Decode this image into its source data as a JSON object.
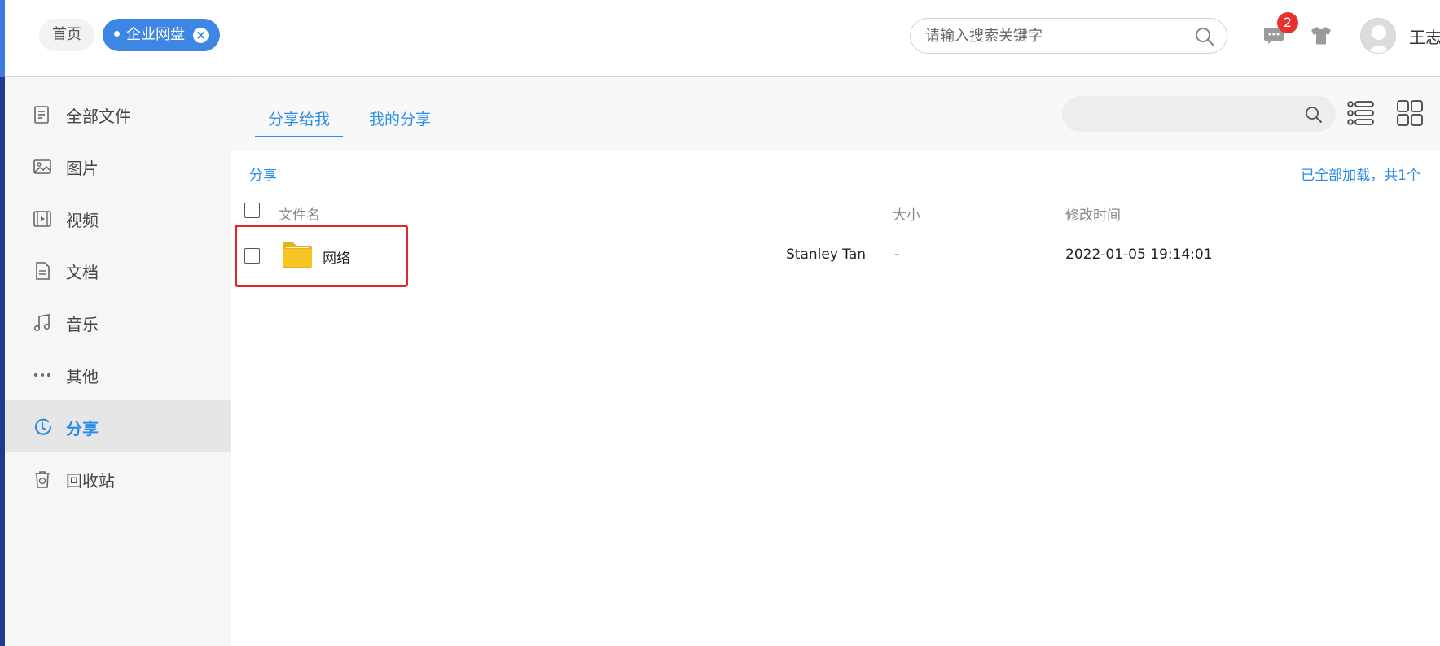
{
  "header": {
    "tabs": [
      {
        "label": "首页"
      },
      {
        "label": "企业网盘"
      }
    ],
    "search": {
      "placeholder": "请输入搜索关键字"
    },
    "message_count": "2",
    "username": "王志强"
  },
  "sidebar": {
    "items": [
      {
        "label": "全部文件",
        "icon": "file-list-icon"
      },
      {
        "label": "图片",
        "icon": "image-icon"
      },
      {
        "label": "视频",
        "icon": "video-icon"
      },
      {
        "label": "文档",
        "icon": "document-icon"
      },
      {
        "label": "音乐",
        "icon": "music-icon"
      },
      {
        "label": "其他",
        "icon": "more-icon"
      },
      {
        "label": "分享",
        "icon": "share-icon",
        "active": true
      },
      {
        "label": "回收站",
        "icon": "recycle-bin-icon"
      }
    ]
  },
  "main": {
    "tabs": [
      {
        "label": "分享给我",
        "active": true
      },
      {
        "label": "我的分享"
      }
    ],
    "breadcrumb": "分享",
    "load_status": "已全部加载，共1个",
    "columns": {
      "name": "文件名",
      "size": "大小",
      "modified": "修改时间"
    },
    "rows": [
      {
        "name": "网络",
        "owner": "Stanley Tan",
        "size": "-",
        "modified": "2022-01-05 19:14:01",
        "type": "folder"
      }
    ]
  },
  "colors": {
    "accent": "#2a8ee8",
    "tab_active": "#3d86e3",
    "badge": "#e83030",
    "highlight": "#e4262b",
    "folder": "#f6c624"
  }
}
